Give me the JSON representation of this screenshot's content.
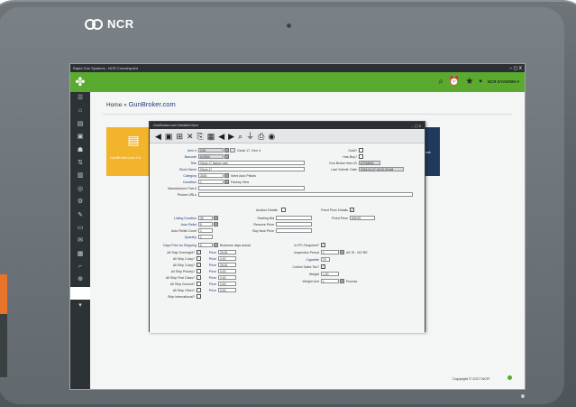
{
  "device": {
    "brand": "NCR"
  },
  "app": {
    "window_title": "Rapid Gun Systems - NCR Counterpoint",
    "window_controls": "– ▢ X",
    "user": "NCR DYADMIN ▾"
  },
  "breadcrumb": {
    "home": "Home",
    "separator": "»",
    "current": "GunBroker.com"
  },
  "tile": {
    "label": "GunBroker.com Co"
  },
  "tile_right": {
    "label": "ook"
  },
  "footer": {
    "copyright": "Copyright © 2017 NCR"
  },
  "dialog": {
    "title": "GunBroker.com Detailed Item",
    "controls": "– ▢ X",
    "fields_left": [
      {
        "label": "Item #",
        "value": "G00"
      },
      {
        "label": "Barcode",
        "value": "647800"
      },
      {
        "label": "Title",
        "value": "Glock 17 factory new"
      },
      {
        "label": "Short Name",
        "value": "Glock 17"
      },
      {
        "label": "Category",
        "value": "3026"
      },
      {
        "label": "Condition",
        "value": "1"
      },
      {
        "label": "Manufacturer Part #",
        "value": ""
      },
      {
        "label": "Picture URLs",
        "value": ""
      }
    ],
    "item_name": "Glock 17, Gen 4",
    "category_name": "Semi Auto Pistols",
    "condition_name": "Factory New",
    "fields_right": [
      {
        "label": "Gold?"
      },
      {
        "label": "Has Buy?"
      },
      {
        "label": "Gun Broker Item ID",
        "value": "67918652"
      },
      {
        "label": "Last Submit. Date",
        "value": "2018-01-07 04:00:25 AM"
      }
    ],
    "auction": {
      "auction_details": "Auction Details",
      "fixed_price_details": "Fixed Price Details",
      "listing_duration": {
        "label": "Listing Duration",
        "value": "30"
      },
      "auto_relist": {
        "label": "Auto Relist",
        "value": "5"
      },
      "auto_relist_count": {
        "label": "Auto Relist Count",
        "value": "1"
      },
      "quantity": {
        "label": "Quantity",
        "value": "1"
      },
      "starting_bid": {
        "label": "Starting Bid"
      },
      "reserve_price": {
        "label": "Reserve Price"
      },
      "buy_now_price": {
        "label": "Buy Now Price"
      },
      "fixed_price": {
        "label": "Fixed Price",
        "value": "599.99"
      },
      "inspection_period": {
        "label": "Days Prior for Shipping",
        "value": "0",
        "suffix": "Business days actual"
      }
    },
    "shipping": [
      {
        "label": "All Ship Overnight?",
        "price_label": "Price",
        "price": "25.00"
      },
      {
        "label": "All Ship 2-day?",
        "price_label": "Price",
        "price": "0.00"
      },
      {
        "label": "All Ship 3-day?",
        "price_label": "Price",
        "price": "25.00"
      },
      {
        "label": "All Ship Priority?",
        "price_label": "Price",
        "price": "0.00"
      },
      {
        "label": "All Ship First Class?",
        "price_label": "Price",
        "price": "0.00"
      },
      {
        "label": "All Ship Ground?",
        "price_label": "Price",
        "price": "0.00"
      },
      {
        "label": "All Ship Other?",
        "price_label": "Price",
        "price": "0.00"
      },
      {
        "label": "Ship International?"
      }
    ],
    "right_group": [
      {
        "label": "Is FFL Required?"
      },
      {
        "label": "Inspection Period",
        "value": "1",
        "suffix": "AS IS - NO RE"
      },
      {
        "label": "Cigarette",
        "value": "FX"
      },
      {
        "label": "Collect Sales Tax?"
      },
      {
        "label": "Weight",
        "value": "1.00"
      },
      {
        "label": "Weight Unit",
        "value": "1",
        "suffix": "Pounds"
      }
    ]
  },
  "colors": {
    "accent": "#5aaa2f",
    "tile": "#f2b42a",
    "sidebar": "#2d3236"
  }
}
